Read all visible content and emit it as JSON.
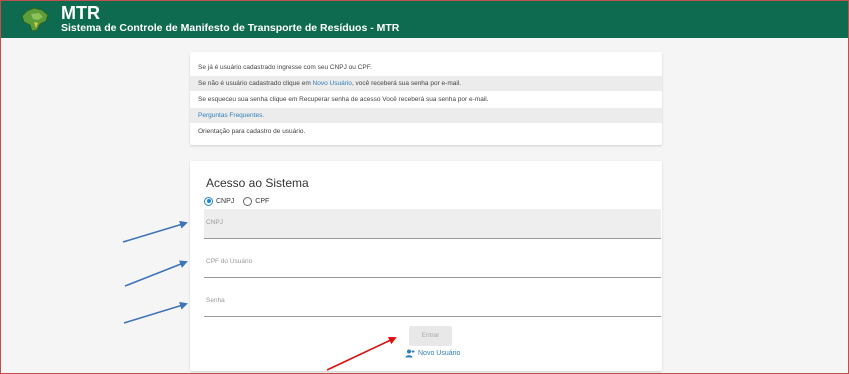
{
  "header": {
    "title": "MTR",
    "subtitle": "Sistema de Controle de Manifesto de Transporte de Resíduos - MTR",
    "background": "#0e6b4f"
  },
  "info": {
    "line1": "Se já é usuário cadastrado ingresse com seu CNPJ ou CPF.",
    "line2_pre": "Se não é usuário cadastrado clique em ",
    "line2_link": "Novo Usuário",
    "line2_post": ", você receberá sua senha por e-mail.",
    "line3": "Se esqueceu sua senha clique em Recuperar senha de acesso Você receberá sua senha por e-mail.",
    "line4_link": "Perguntas Frequentes.",
    "line5": "Orientação para cadastro de usuário."
  },
  "login": {
    "title": "Acesso ao Sistema",
    "radio_cnpj": "CNPJ",
    "radio_cpf": "CPF",
    "selected": "CNPJ",
    "field_cnpj": "CNPJ",
    "field_cpf_usuario": "CPF do Usuário",
    "field_senha": "Senha",
    "enter_button": "Entrar",
    "new_user_link": "Novo Usuário",
    "new_user_icon": "person-add-icon"
  },
  "colors": {
    "accent": "#1a8ad4",
    "link": "#2f7fb8",
    "annotation_blue": "#3f74b8",
    "annotation_red": "#e01010"
  }
}
